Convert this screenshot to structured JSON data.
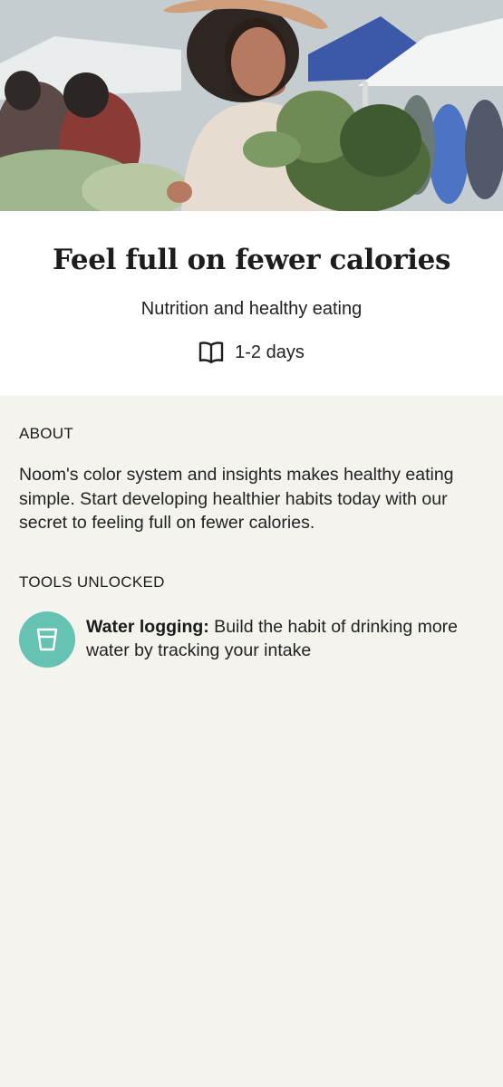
{
  "hero": {
    "image_description": "Woman with curly hair and sun hat holding leafy greens at an outdoor farmers market"
  },
  "program": {
    "title": "Feel full on fewer calories",
    "category": "Nutrition and healthy eating",
    "duration_icon": "book-open-icon",
    "duration": "1-2 days"
  },
  "about": {
    "label": "ABOUT",
    "text": "Noom's color system and insights makes healthy eating simple. Start developing healthier habits today with our secret to feeling full on fewer calories."
  },
  "tools": {
    "label": "TOOLS UNLOCKED",
    "items": [
      {
        "icon": "water-glass-icon",
        "icon_color": "#66c3b4",
        "name": "Water logging:",
        "description": " Build the habit of drinking more water by tracking your intake"
      }
    ]
  }
}
